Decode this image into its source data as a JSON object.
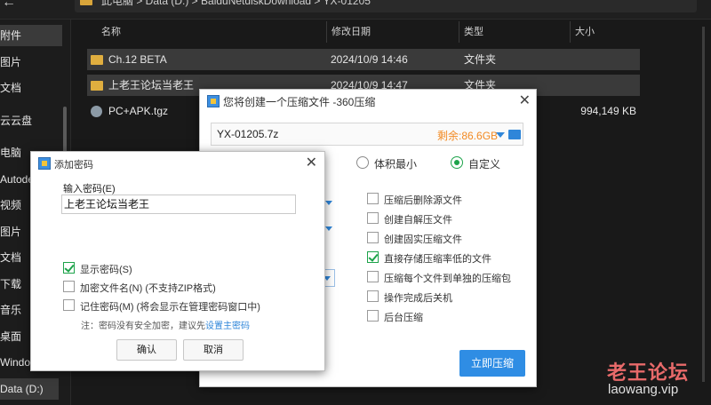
{
  "breadcrumb": {
    "text": "此电脑  >  Data (D:)  >  BaiduNetdiskDownload  >  YX-01205"
  },
  "sidebar": {
    "items": [
      {
        "label": "附件",
        "selected": true
      },
      {
        "label": "图片"
      },
      {
        "label": "文档"
      },
      {
        "label": "云云盘"
      },
      {
        "label": "电脑"
      },
      {
        "label": "Autode"
      },
      {
        "label": "视频"
      },
      {
        "label": "图片"
      },
      {
        "label": "文档"
      },
      {
        "label": "下载"
      },
      {
        "label": "音乐"
      },
      {
        "label": "桌面"
      },
      {
        "label": "Windo"
      },
      {
        "label": "Data (D:)",
        "selected": true
      }
    ]
  },
  "columns": {
    "name": "名称",
    "date": "修改日期",
    "type": "类型",
    "size": "大小"
  },
  "files": [
    {
      "name": "Ch.12 BETA",
      "date": "2024/10/9 14:46",
      "type": "文件夹",
      "size": "",
      "icon": "folder-icon"
    },
    {
      "name": "上老王论坛当老王",
      "date": "2024/10/9 14:47",
      "type": "文件夹",
      "size": "",
      "icon": "folder-icon"
    },
    {
      "name": "PC+APK.tgz",
      "date": "",
      "type": "",
      "size": "994,149 KB",
      "icon": "archive-icon"
    }
  ],
  "compress_dialog": {
    "title": "您将创建一个压缩文件 -360压缩",
    "filename": "YX-01205.7z",
    "free_space": "剩余:86.6GB",
    "radio_min_size": "体积最小",
    "radio_custom": "自定义",
    "radio_custom_selected": true,
    "options": [
      {
        "label": "压缩后删除源文件",
        "checked": false
      },
      {
        "label": "创建自解压文件",
        "checked": false
      },
      {
        "label": "创建固实压缩文件",
        "checked": false
      },
      {
        "label": "直接存储压缩率低的文件",
        "checked": true
      },
      {
        "label": "压缩每个文件到单独的压缩包",
        "checked": false
      },
      {
        "label": "操作完成后关机",
        "checked": false
      },
      {
        "label": "后台压缩",
        "checked": false
      }
    ],
    "compress_button": "立即压缩"
  },
  "password_dialog": {
    "title": "添加密码",
    "input_label": "输入密码(E)",
    "password_value": "上老王论坛当老王",
    "options": [
      {
        "label": "显示密码(S)",
        "checked": true
      },
      {
        "label": "加密文件名(N) (不支持ZIP格式)",
        "checked": false
      },
      {
        "label": "记住密码(M) (将会显示在管理密码窗口中)",
        "checked": false
      }
    ],
    "note": "注：密码没有安全加密，建议先",
    "note_link": "设置主密码",
    "ok_button": "确认",
    "cancel_button": "取消"
  },
  "watermark": {
    "title": "老王论坛",
    "url": "laowang.vip"
  },
  "colors": {
    "accent_blue": "#2f8de4",
    "free_space_orange": "#f28a23",
    "check_green": "#1da34a",
    "watermark_red": "#e86a6a"
  }
}
